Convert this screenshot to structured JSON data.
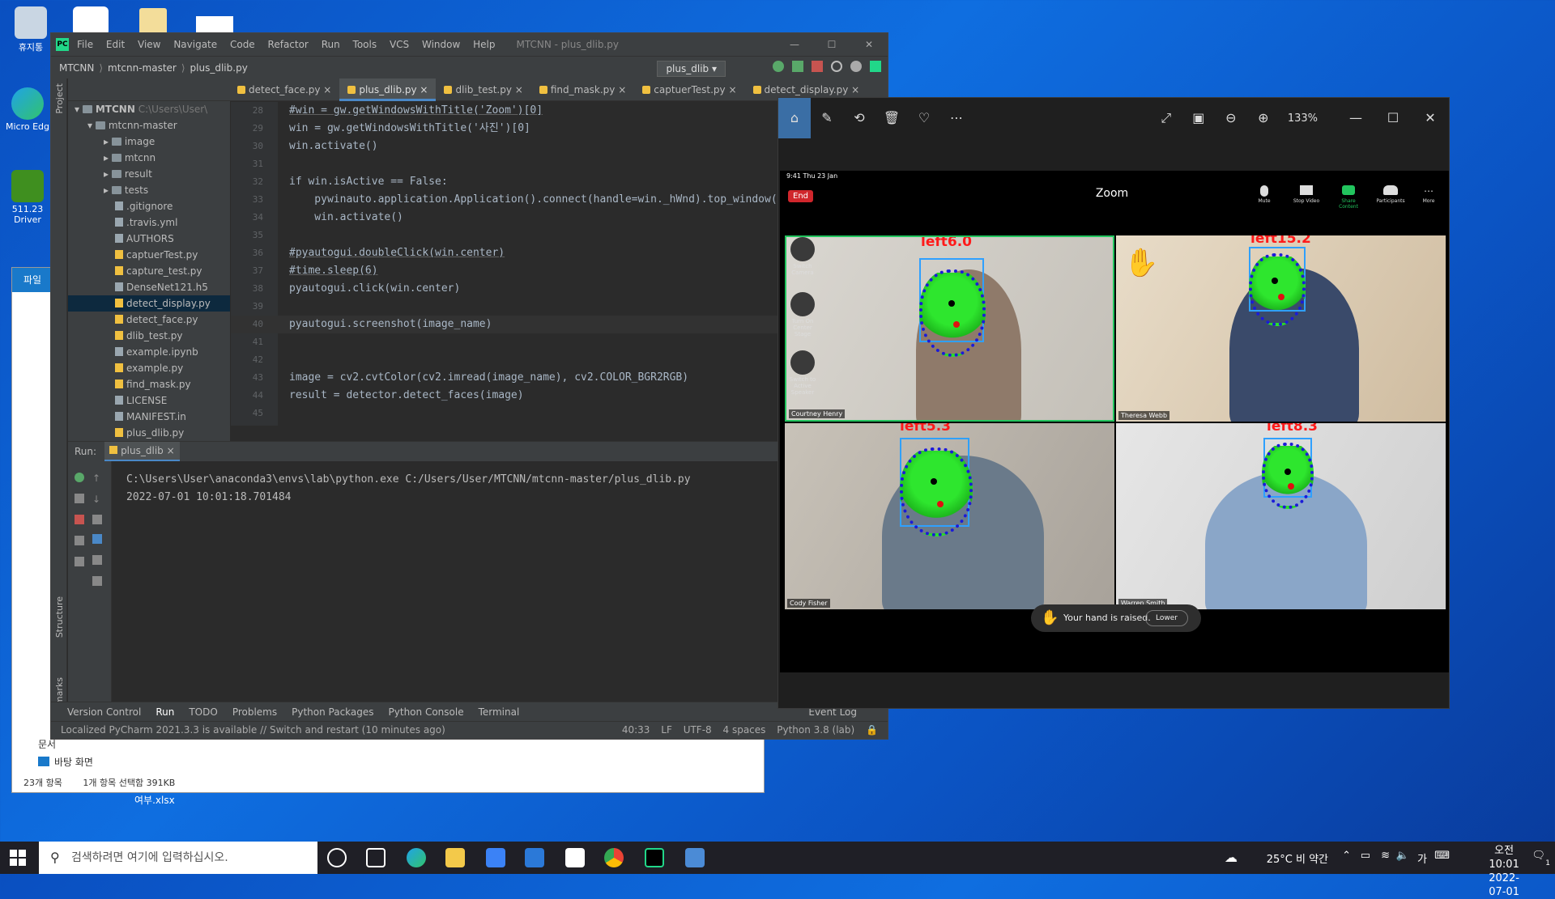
{
  "desktop": {
    "icons": [
      {
        "label": "휴지통"
      },
      {
        "label": "Micro Edg"
      },
      {
        "label": "511.23 Driver"
      }
    ]
  },
  "explorer": {
    "ribbon_tab": "파일",
    "nav_items": [
      "문서",
      "바탕 화면"
    ],
    "status_count": "23개 항목",
    "status_selected": "1개 항목 선택함 391KB",
    "desktop_file": "여부.xlsx"
  },
  "pycharm": {
    "menu": [
      "File",
      "Edit",
      "View",
      "Navigate",
      "Code",
      "Refactor",
      "Run",
      "Tools",
      "VCS",
      "Window",
      "Help"
    ],
    "window_title": "MTCNN - plus_dlib.py",
    "breadcrumb": [
      "MTCNN",
      "mtcnn-master",
      "plus_dlib.py"
    ],
    "run_config": "plus_dlib",
    "tabs": [
      "detect_face.py",
      "plus_dlib.py",
      "dlib_test.py",
      "find_mask.py",
      "captuerTest.py",
      "detect_display.py"
    ],
    "active_tab": 1,
    "project_label": "Project",
    "structure_label": "Structure",
    "bookmarks_label": "Bookmarks",
    "tree": {
      "root": "MTCNN",
      "root_path": "C:\\Users\\User\\",
      "sub": "mtcnn-master",
      "folders": [
        "image",
        "mtcnn",
        "result",
        "tests"
      ],
      "files": [
        ".gitignore",
        ".travis.yml",
        "AUTHORS",
        "captuerTest.py",
        "capture_test.py",
        "DenseNet121.h5",
        "detect_display.py",
        "detect_face.py",
        "dlib_test.py",
        "example.ipynb",
        "example.py",
        "find_mask.py",
        "LICENSE",
        "MANIFEST.in",
        "plus_dlib.py"
      ],
      "selected": "detect_display.py"
    },
    "code_lines": [
      {
        "n": "28",
        "t": "#win = gw.getWindowsWithTitle('Zoom')[0]"
      },
      {
        "n": "29",
        "t": "win = gw.getWindowsWithTitle('사진')[0]"
      },
      {
        "n": "30",
        "t": "win.activate()"
      },
      {
        "n": "31",
        "t": ""
      },
      {
        "n": "32",
        "t": "if win.isActive == False:"
      },
      {
        "n": "33",
        "t": "    pywinauto.application.Application().connect(handle=win._hWnd).top_window("
      },
      {
        "n": "34",
        "t": "    win.activate()"
      },
      {
        "n": "35",
        "t": ""
      },
      {
        "n": "36",
        "t": "#pyautogui.doubleClick(win.center)"
      },
      {
        "n": "37",
        "t": "#time.sleep(6)"
      },
      {
        "n": "38",
        "t": "pyautogui.click(win.center)"
      },
      {
        "n": "39",
        "t": ""
      },
      {
        "n": "40",
        "t": "pyautogui.screenshot(image_name)"
      },
      {
        "n": "41",
        "t": ""
      },
      {
        "n": "42",
        "t": ""
      },
      {
        "n": "43",
        "t": "image = cv2.cvtColor(cv2.imread(image_name), cv2.COLOR_BGR2RGB)"
      },
      {
        "n": "44",
        "t": "result = detector.detect_faces(image)"
      },
      {
        "n": "45",
        "t": ""
      }
    ],
    "current_line": "40",
    "run_label": "Run:",
    "run_tab": "plus_dlib",
    "console": [
      "C:\\Users\\User\\anaconda3\\envs\\lab\\python.exe C:/Users/User/MTCNN/mtcnn-master/plus_dlib.py",
      "2022-07-01 10:01:18.701484"
    ],
    "bottom_tabs": [
      "Version Control",
      "Run",
      "TODO",
      "Problems",
      "Python Packages",
      "Python Console",
      "Terminal"
    ],
    "event_log": "Event Log",
    "status_msg": "Localized PyCharm 2021.3.3 is available // Switch and restart (10 minutes ago)",
    "status_right": [
      "40:33",
      "LF",
      "UTF-8",
      "4 spaces",
      "Python 3.8 (lab)"
    ]
  },
  "photos": {
    "zoom_level": "133%",
    "zoom_meeting": {
      "time": "9:41   Thu 23 Jan",
      "end_label": "End",
      "title": "Zoom",
      "controls": [
        "Mute",
        "Stop Video",
        "Share Content",
        "Participants",
        "More"
      ],
      "side_controls": [
        "Switch Camera",
        "Turn On Center Stage",
        "Switch to Active Speaker"
      ],
      "participants": [
        {
          "name": "Courtney Henry",
          "label": "left6.0"
        },
        {
          "name": "Theresa Webb",
          "label": "left15.2"
        },
        {
          "name": "Cody Fisher",
          "label": "left5.3"
        },
        {
          "name": "Warren Smith",
          "label": "left8.3"
        }
      ],
      "hand_raised": "Your hand is raised.",
      "lower_label": "Lower"
    }
  },
  "taskbar": {
    "search_placeholder": "검색하려면 여기에 입력하십시오.",
    "weather": "25°C  비 약간",
    "ime": "가",
    "time": "오전 10:01",
    "date": "2022-07-01",
    "notif_count": "1"
  },
  "colors": {
    "desktop": "#0b5cd0",
    "pycharm_bg": "#2b2b2b",
    "face_mask": "#2ee62e",
    "face_box": "#2fa0ff",
    "face_label": "#ff1a1a"
  }
}
